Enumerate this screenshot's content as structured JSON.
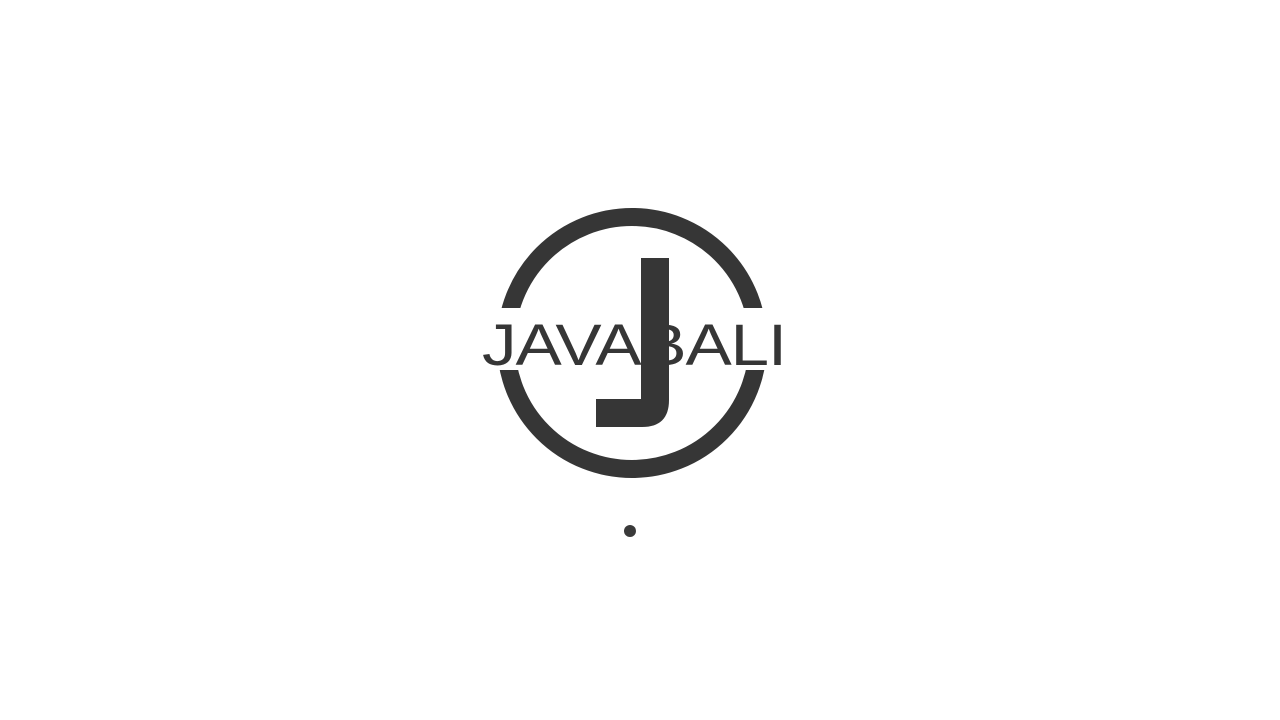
{
  "splash": {
    "logo": {
      "icon": "javabali-logo",
      "wordmark": "JAVABALI",
      "color": "#363636"
    },
    "loading_indicator": {
      "icon": "loading-dot",
      "color": "#3a3a3a"
    },
    "background_color": "#ffffff"
  }
}
